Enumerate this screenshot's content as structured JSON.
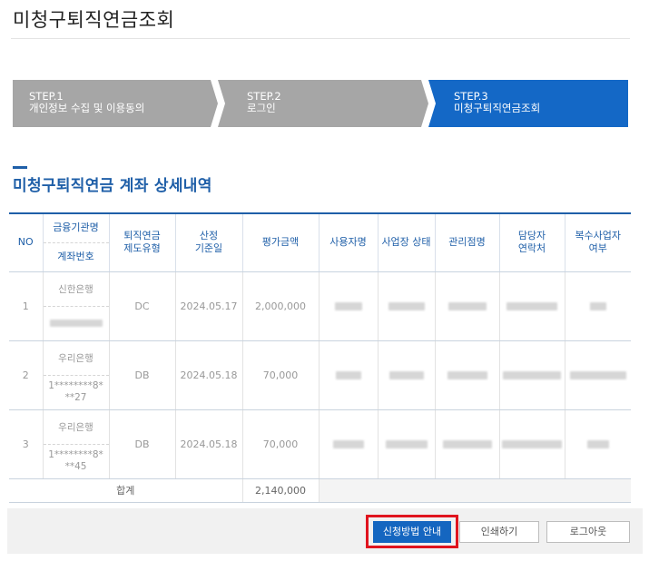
{
  "page": {
    "title": "미청구퇴직연금조회"
  },
  "steps": [
    {
      "num": "STEP.1",
      "label": "개인정보 수집 및 이용동의",
      "active": false
    },
    {
      "num": "STEP.2",
      "label": "로그인",
      "active": false
    },
    {
      "num": "STEP.3",
      "label": "미청구퇴직연금조회",
      "active": true
    }
  ],
  "section": {
    "title": "미청구퇴직연금 계좌 상세내역"
  },
  "table": {
    "headers": {
      "no": "NO",
      "institution": "금융기관명",
      "account": "계좌번호",
      "plan_type": "퇴직연금\n제도유형",
      "calc_date": "산정\n기준일",
      "amount": "평가금액",
      "employer": "사용자명",
      "workplace_status": "사업장 상태",
      "branch": "관리점명",
      "contact": "담당자\n연락처",
      "multi_employer": "복수사업자\n여부"
    },
    "rows": [
      {
        "no": "1",
        "institution": "신한은행",
        "account": "***************70",
        "plan_type": "DC",
        "calc_date": "2024.05.17",
        "amount": "2,000,000"
      },
      {
        "no": "2",
        "institution": "우리은행",
        "account": "1********8*\n**27",
        "plan_type": "DB",
        "calc_date": "2024.05.18",
        "amount": "70,000"
      },
      {
        "no": "3",
        "institution": "우리은행",
        "account": "1********8*\n**45",
        "plan_type": "DB",
        "calc_date": "2024.05.18",
        "amount": "70,000"
      }
    ],
    "total": {
      "label": "합계",
      "amount": "2,140,000"
    }
  },
  "buttons": {
    "guide": "신청방법 안내",
    "print": "인쇄하기",
    "logout": "로그아웃"
  },
  "colors": {
    "accent": "#1f5fa8",
    "step_active": "#1468c6",
    "step_inactive": "#a6a6a6",
    "highlight": "#e0141e"
  }
}
